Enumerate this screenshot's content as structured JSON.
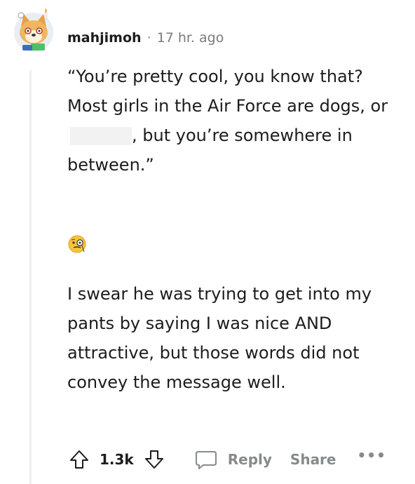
{
  "comment": {
    "username": "mahjimoh",
    "separator": "·",
    "timestamp": "17 hr. ago",
    "paragraph1_part1": "“You’re pretty cool, you know that? Most girls in the Air Force are dogs, or",
    "paragraph1_part2": ",",
    "paragraph1_part3": "but you’re somewhere in between.”",
    "paragraph2": "I swear he was trying to get into my pants by saying I was nice AND attractive, but those words did not convey the message well.",
    "emoji": "face-with-monocle"
  },
  "actions": {
    "vote_count": "1.3k",
    "reply_label": "Reply",
    "share_label": "Share",
    "more_label": "•••"
  },
  "colors": {
    "text": "#1c1c1c",
    "muted": "#878a8c",
    "thread_line": "#edeff1",
    "redaction": "#f2f2f2"
  }
}
